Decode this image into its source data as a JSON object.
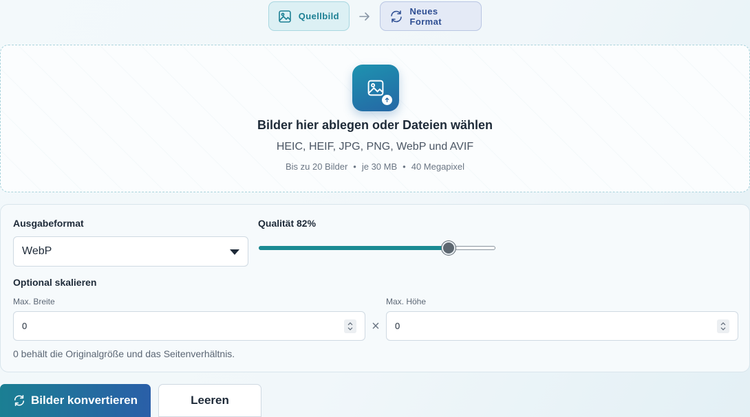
{
  "steps": {
    "source_label": "Quellbild",
    "target_label": "Neues Format"
  },
  "dropzone": {
    "title": "Bilder hier ablegen oder Dateien wählen",
    "formats": "HEIC, HEIF, JPG, PNG, WebP und AVIF",
    "limits": [
      "Bis zu 20 Bilder",
      "je 30 MB",
      "40 Megapixel"
    ],
    "separator": "•"
  },
  "settings": {
    "output_format_label": "Ausgabeformat",
    "output_format_value": "WebP",
    "quality_label": "Qualität 82%",
    "quality_percent": 82,
    "scale_label": "Optional skalieren",
    "max_width_label": "Max. Breite",
    "max_width_value": "0",
    "max_height_label": "Max. Höhe",
    "max_height_value": "0",
    "times_symbol": "×",
    "hint": "0 behält die Originalgröße und das Seitenverhältnis."
  },
  "actions": {
    "convert_label": "Bilder konvertieren",
    "clear_label": "Leeren"
  },
  "colors": {
    "accent_teal": "#1b7f93",
    "accent_blue": "#2a5fa8",
    "slider_fill": "#1a8a93",
    "text_dark": "#1e2a38"
  },
  "icons": {
    "source": "image-icon",
    "target": "refresh-icon",
    "arrow": "arrow-right-icon",
    "upload": "image-upload-icon",
    "convert": "refresh-icon"
  }
}
